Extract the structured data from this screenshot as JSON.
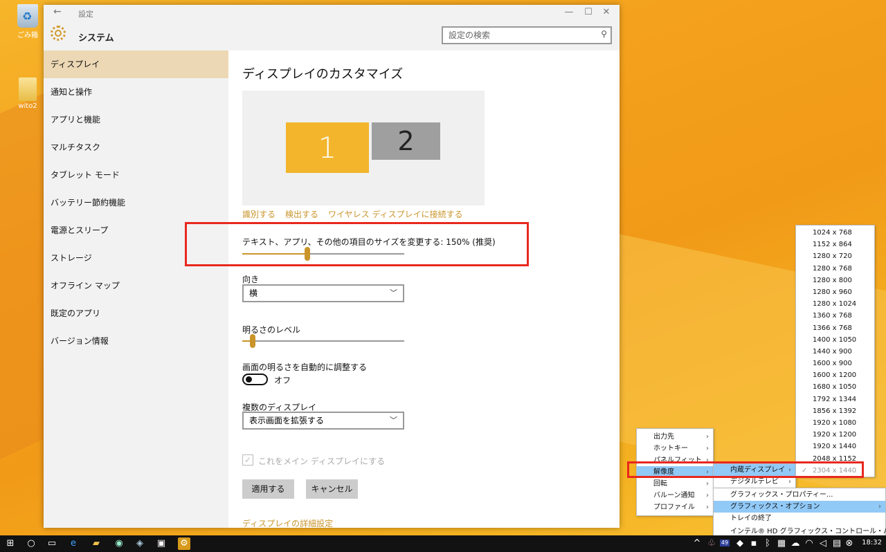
{
  "desktop": {
    "icons": [
      {
        "label": "ごみ箱"
      },
      {
        "label": "wito2"
      }
    ]
  },
  "window": {
    "title": "設定",
    "app_name": "システム",
    "search_placeholder": "設定の検索",
    "controls": {
      "minimize": "—",
      "maximize": "☐",
      "close": "✕"
    }
  },
  "sidebar": {
    "items": [
      {
        "label": "ディスプレイ"
      },
      {
        "label": "通知と操作"
      },
      {
        "label": "アプリと機能"
      },
      {
        "label": "マルチタスク"
      },
      {
        "label": "タブレット モード"
      },
      {
        "label": "バッテリー節約機能"
      },
      {
        "label": "電源とスリープ"
      },
      {
        "label": "ストレージ"
      },
      {
        "label": "オフライン マップ"
      },
      {
        "label": "既定のアプリ"
      },
      {
        "label": "バージョン情報"
      }
    ],
    "active_index": 0
  },
  "display": {
    "title": "ディスプレイのカスタマイズ",
    "monitor1": "1",
    "monitor2": "2",
    "links": {
      "identify": "識別する",
      "detect": "検出する",
      "wireless": "ワイヤレス ディスプレイに接続する"
    },
    "scale_label": "テキスト、アプリ、その他の項目のサイズを変更する: 150% (推奨)",
    "scale_value": 0.4,
    "orientation_label": "向き",
    "orientation_value": "横",
    "brightness_label": "明るさのレベル",
    "brightness_value": 0.05,
    "auto_brightness_label": "画面の明るさを自動的に調整する",
    "auto_brightness_state": "オフ",
    "multi_display_label": "複数のディスプレイ",
    "multi_display_value": "表示画面を拡張する",
    "main_display_label": "これをメイン ディスプレイにする",
    "apply_button": "適用する",
    "cancel_button": "キャンセル",
    "advanced_link": "ディスプレイの詳細設定"
  },
  "tray_menu": {
    "items": [
      {
        "label": "出力先"
      },
      {
        "label": "ホットキー"
      },
      {
        "label": "パネルフィット"
      },
      {
        "label": "解像度"
      },
      {
        "label": "回転"
      },
      {
        "label": "バルーン通知"
      },
      {
        "label": "プロファイル"
      }
    ],
    "highlighted_index": 3
  },
  "resolution_submenu": {
    "items": [
      {
        "label": "内蔵ディスプレイ"
      },
      {
        "label": "デジタルテレビ"
      }
    ]
  },
  "graphics_menu": {
    "items": [
      {
        "label": "グラフィックス・プロパティー..."
      },
      {
        "label": "グラフィックス・オプション"
      },
      {
        "label": "トレイの終了"
      },
      {
        "label": "インテル® HD グラフィックス・コントロール・パネル"
      }
    ]
  },
  "resolutions": {
    "items": [
      "1024 x 768",
      "1152 x 864",
      "1280 x 720",
      "1280 x 768",
      "1280 x 800",
      "1280 x 960",
      "1280 x 1024",
      "1360 x 768",
      "1366 x 768",
      "1400 x 1050",
      "1440 x 900",
      "1600 x 900",
      "1600 x 1200",
      "1680 x 1050",
      "1792 x 1344",
      "1856 x 1392",
      "1920 x 1080",
      "1920 x 1200",
      "1920 x 1440",
      "2048 x 1152",
      "2304 x 1440"
    ],
    "selected": "2304 x 1440"
  },
  "taskbar": {
    "tray_badge": "49",
    "clock": "18:32"
  },
  "colors": {
    "accent": "#c9952b",
    "highlight_red": "#e8281e",
    "menu_highlight": "#91c9f7"
  }
}
